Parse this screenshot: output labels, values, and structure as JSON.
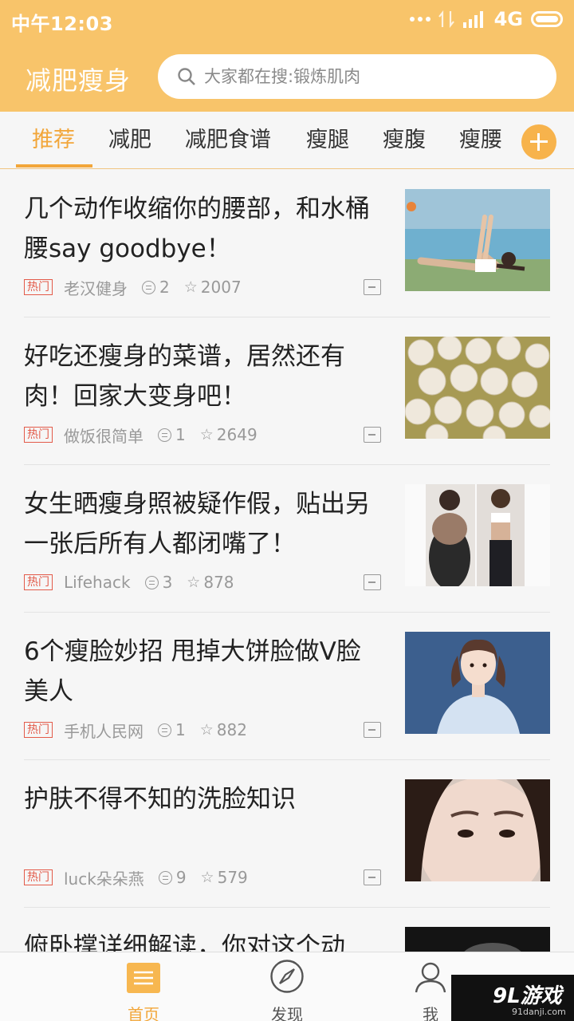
{
  "status": {
    "time": "中午12:03",
    "network": "4G"
  },
  "header": {
    "title": "减肥瘦身",
    "search_placeholder": "大家都在搜:锻炼肌肉"
  },
  "tabs": [
    "推荐",
    "减肥",
    "减肥食谱",
    "瘦腿",
    "瘦腹",
    "瘦腰"
  ],
  "feed": [
    {
      "title": "几个动作收缩你的腰部，和水桶腰say goodbye！",
      "badge": "热门",
      "author": "老汉健身",
      "comments": "2",
      "likes": "2007",
      "thumb": "yoga-photo"
    },
    {
      "title": "好吃还瘦身的菜谱，居然还有肉！回家大变身吧！",
      "badge": "热门",
      "author": "做饭很简单",
      "comments": "1",
      "likes": "2649",
      "thumb": "meatballs-photo"
    },
    {
      "title": "女生晒瘦身照被疑作假，贴出另一张后所有人都闭嘴了！",
      "badge": "热门",
      "author": "Lifehack",
      "comments": "3",
      "likes": "878",
      "thumb": "before-after-photo"
    },
    {
      "title": "6个瘦脸妙招 甩掉大饼脸做V脸美人",
      "badge": "热门",
      "author": "手机人民网",
      "comments": "1",
      "likes": "882",
      "thumb": "girl-portrait-photo"
    },
    {
      "title": "护肤不得不知的洗脸知识",
      "badge": "热门",
      "author": "luck朵朵燕",
      "comments": "9",
      "likes": "579",
      "thumb": "face-closeup-photo"
    },
    {
      "title": "俯卧撑详细解读，你对这个动",
      "thumb": "dark-photo"
    }
  ],
  "bottom_nav": [
    "首页",
    "发现",
    "我"
  ],
  "watermark": {
    "main": "9L游戏",
    "sub": "91danji.com"
  }
}
